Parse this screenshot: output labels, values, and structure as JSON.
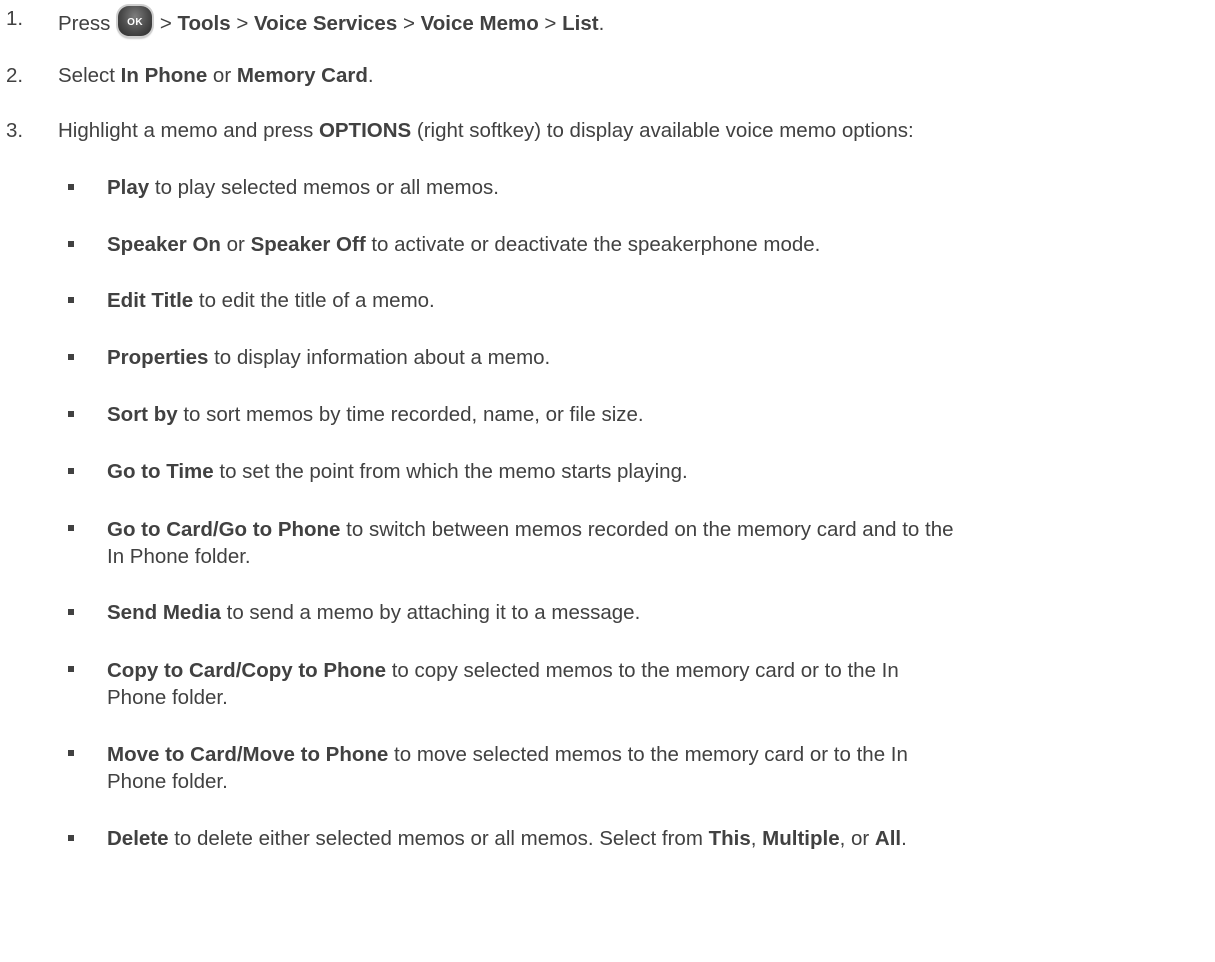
{
  "steps": [
    {
      "num": "1.",
      "parts": [
        "Press",
        "> ",
        "Tools",
        " > ",
        "Voice Services",
        " > ",
        "Voice Memo",
        " > ",
        "List",
        "."
      ],
      "ok_label": "OK"
    },
    {
      "num": "2.",
      "parts": [
        "Select ",
        "In Phone",
        " or ",
        "Memory Card",
        "."
      ]
    },
    {
      "num": "3.",
      "parts": [
        "Highlight a memo and press ",
        "OPTIONS",
        " (right softkey) to display available voice memo options:"
      ]
    }
  ],
  "options": [
    {
      "term": "Play",
      "desc": " to play selected memos or all memos."
    },
    {
      "term": "Speaker On",
      "mid": " or ",
      "term2": "Speaker Off",
      "desc": " to activate or deactivate the speakerphone mode."
    },
    {
      "term": "Edit Title",
      "desc": " to edit the title of a memo."
    },
    {
      "term": "Properties",
      "desc": " to display information about a memo."
    },
    {
      "term": "Sort by",
      "desc": " to sort memos by time recorded, name, or file size."
    },
    {
      "term": "Go to Time",
      "desc": " to set the point from which the memo starts playing."
    },
    {
      "term": "Go to Card/Go to Phone",
      "desc": " to switch between memos recorded on the memory card and to the",
      "line2": "In Phone folder."
    },
    {
      "term": "Send Media",
      "desc": " to send a memo by attaching it to a message."
    },
    {
      "term": "Copy to Card/Copy to Phone",
      "desc": " to copy selected memos to the memory card or to the In",
      "line2": "Phone folder."
    },
    {
      "term": "Move to Card/Move to Phone",
      "desc": " to move selected memos to the memory card or to the In",
      "line2": "Phone folder."
    },
    {
      "term": "Delete",
      "desc": " to delete either selected memos or all memos. Select from ",
      "t1": "This",
      "s1": ", ",
      "t2": "Multiple",
      "s2": ", or ",
      "t3": "All",
      "end": "."
    }
  ]
}
